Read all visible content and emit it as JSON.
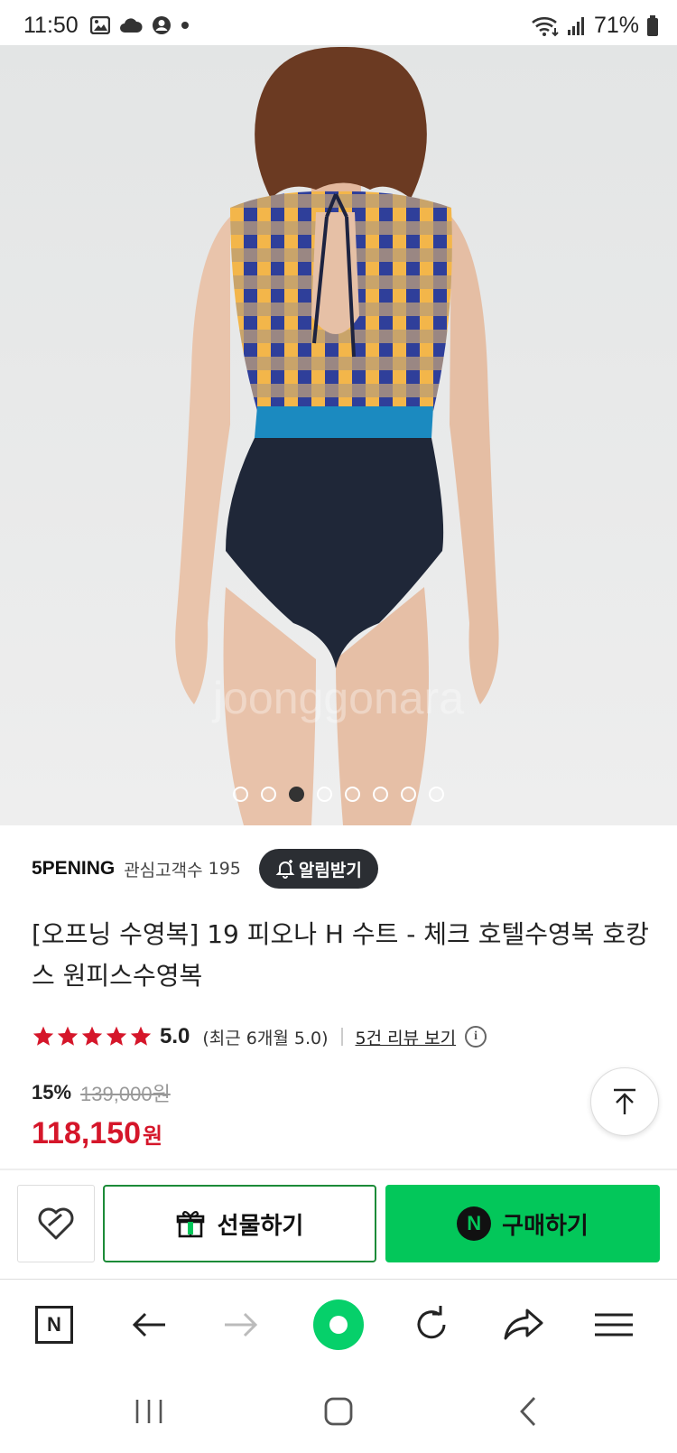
{
  "status_bar": {
    "time": "11:50",
    "battery": "71%",
    "icons": [
      "gallery-icon",
      "cloud-icon",
      "account-icon",
      "dot-icon",
      "wifi-icon",
      "signal-icon",
      "battery-icon"
    ]
  },
  "gallery": {
    "total_images": 8,
    "active_index": 2
  },
  "store": {
    "name": "5PENING",
    "fav_label": "관심고객수",
    "fav_count": "195",
    "alarm_button": "알림받기"
  },
  "product": {
    "title": "[오프닝 수영복] 19 피오나 H 수트 - 체크 호텔수영복 호캉스 원피스수영복"
  },
  "rating": {
    "stars": 5,
    "score": "5.0",
    "recent": "(최근 6개월 5.0)",
    "review_link": "5건 리뷰 보기",
    "info_icon": "i"
  },
  "price": {
    "discount": "15%",
    "original": "139,000원",
    "sale": "118,150",
    "currency": "원"
  },
  "actions": {
    "gift": "선물하기",
    "buy": "구매하기",
    "buy_badge": "N"
  },
  "browser_bar": {
    "home_badge": "N",
    "icons": [
      "naver-home-icon",
      "back-arrow-icon",
      "forward-arrow-icon",
      "green-dot-icon",
      "refresh-icon",
      "share-icon",
      "menu-icon"
    ]
  },
  "colors": {
    "accent_green": "#03c75a",
    "price_red": "#d5162a",
    "star_red": "#d5162a",
    "dark_button": "#2b2e33"
  }
}
